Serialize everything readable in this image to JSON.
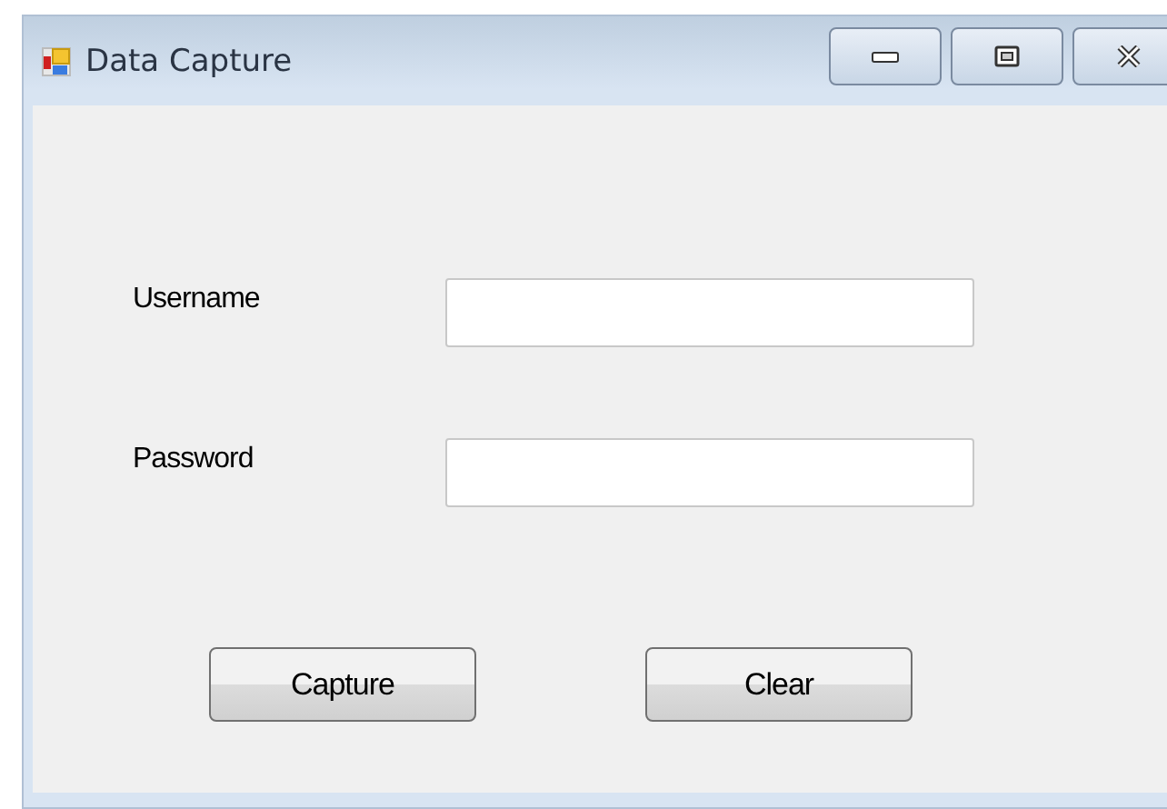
{
  "window": {
    "title": "Data Capture"
  },
  "fields": [
    {
      "label": "Username"
    },
    {
      "label": "Password"
    }
  ],
  "buttons": [
    "Capture",
    "Clear"
  ]
}
